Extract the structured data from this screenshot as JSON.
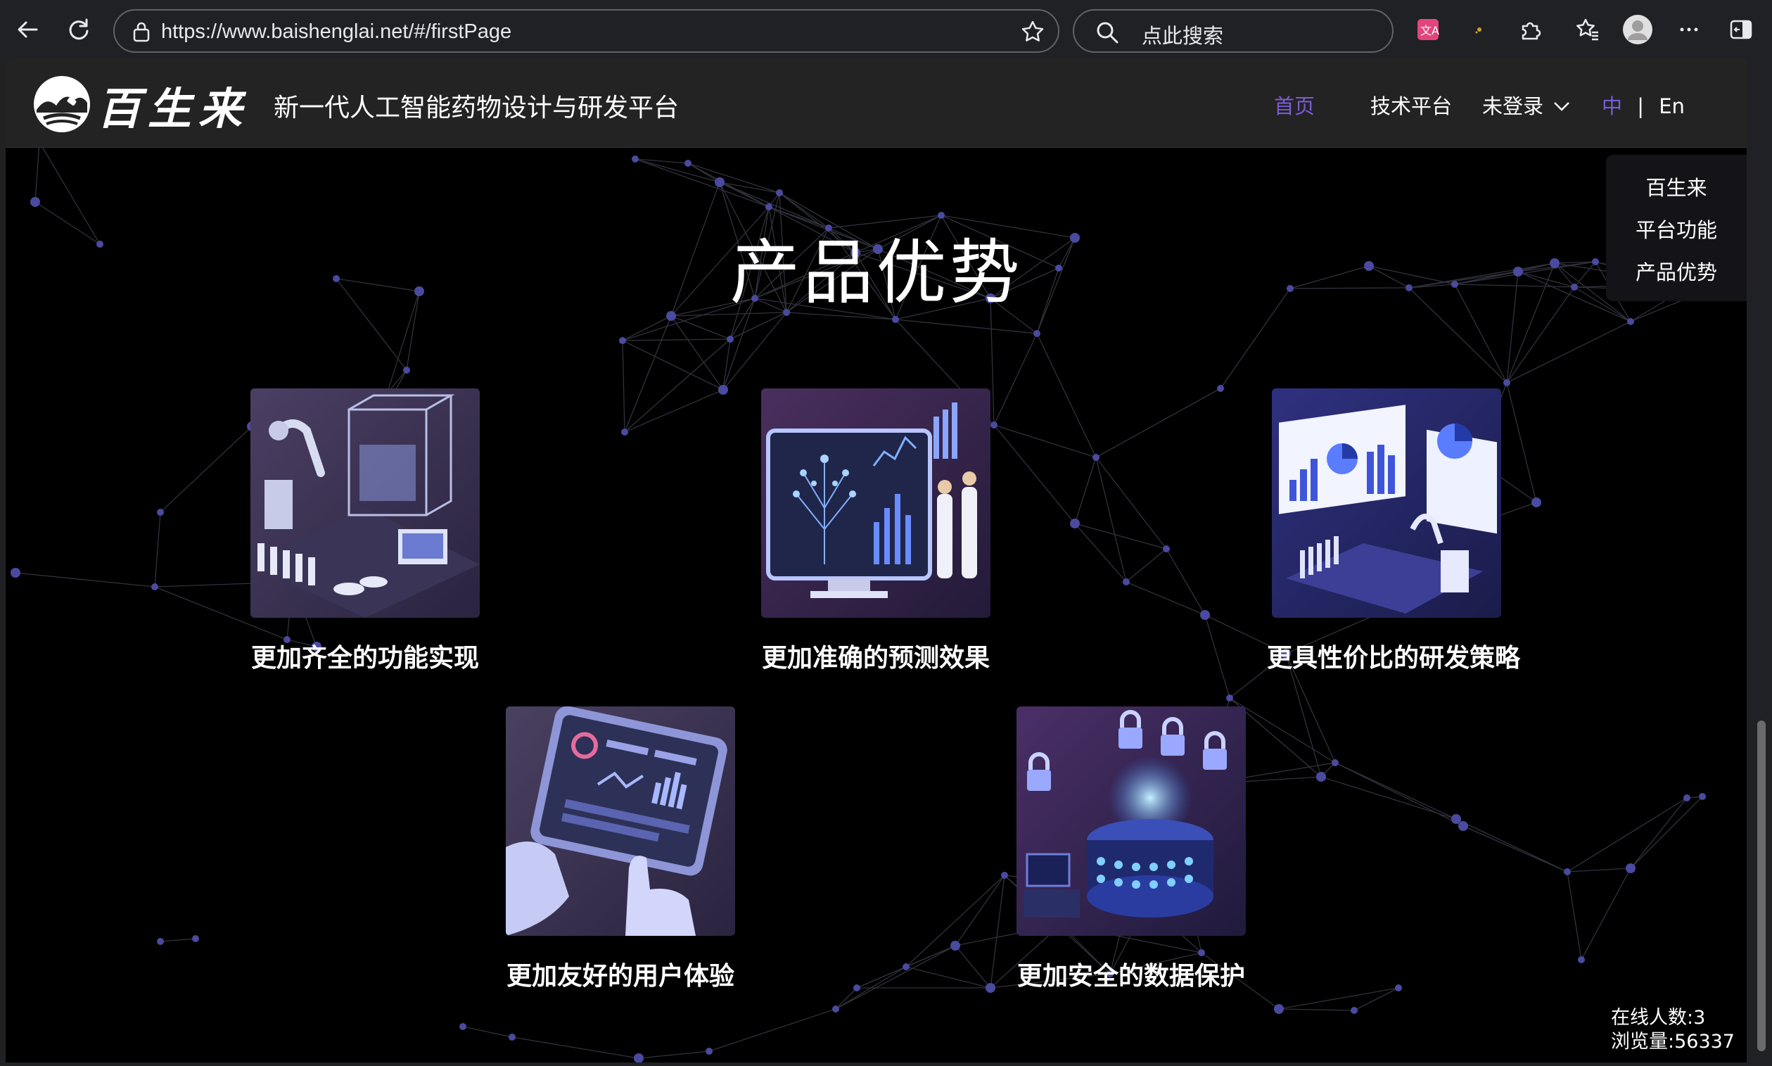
{
  "browser": {
    "url": "https://www.baishenglai.net/#/firstPage",
    "search_placeholder": "点此搜索",
    "icons": [
      "back-arrow-icon",
      "refresh-icon",
      "lock-icon",
      "favorite-star-icon",
      "search-icon",
      "translate-icon",
      "extension-icon",
      "puzzle-icon",
      "favorites-icon",
      "profile-avatar",
      "more-icon",
      "sidebar-icon"
    ]
  },
  "header": {
    "brand_name": "百生来",
    "subtitle": "新一代人工智能药物设计与研发平台",
    "nav": {
      "home": "首页",
      "tech_platform": "技术平台",
      "login": "未登录",
      "lang_zh": "中",
      "lang_sep": "|",
      "lang_en": "En"
    }
  },
  "side_menu": {
    "items": [
      "百生来",
      "平台功能",
      "产品优势"
    ]
  },
  "section": {
    "title": "产品优势",
    "cards": [
      {
        "label": "更加齐全的功能实现"
      },
      {
        "label": "更加准确的预测效果"
      },
      {
        "label": "更具性价比的研发策略"
      },
      {
        "label": "更加友好的用户体验"
      },
      {
        "label": "更加安全的数据保护"
      }
    ]
  },
  "stats": {
    "online": "在线人数:3",
    "views": "浏览量:56337"
  },
  "colors": {
    "accent": "#7b5cd6",
    "header_bg": "#232323",
    "page_bg": "#000000",
    "node": "#4a4a9a"
  }
}
